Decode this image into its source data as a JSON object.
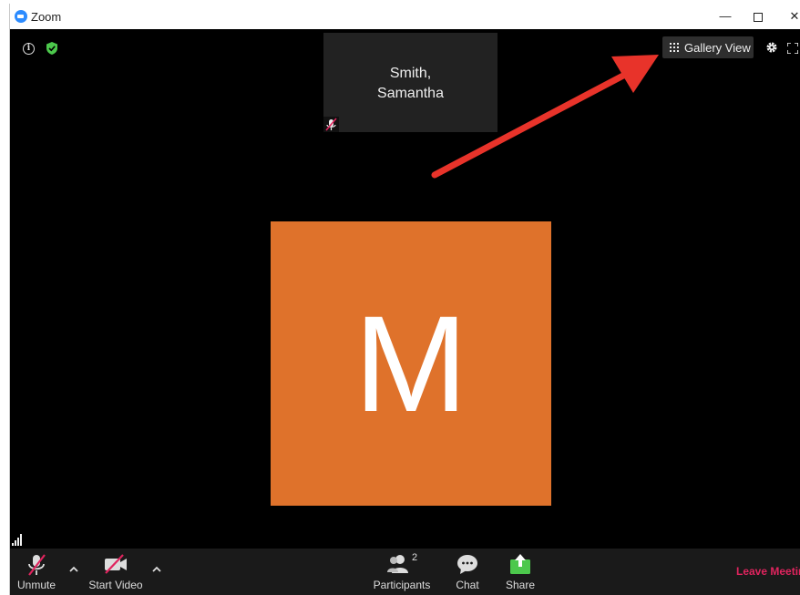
{
  "window": {
    "title": "Zoom",
    "controls": {
      "minimize": "—",
      "maximize": "",
      "close": "✕"
    }
  },
  "stage": {
    "info_icon": "i",
    "thumbnail": {
      "name_line1": "Smith,",
      "name_line2": "Samantha"
    },
    "gallery_view_label": "Gallery View",
    "active_speaker_initial": "M",
    "avatar_color": "#df722b"
  },
  "toolbar": {
    "unmute_label": "Unmute",
    "start_video_label": "Start Video",
    "participants_label": "Participants",
    "participants_count": "2",
    "chat_label": "Chat",
    "share_label": "Share",
    "leave_label": "Leave Meeting"
  },
  "colors": {
    "accent_green": "#4cc84c",
    "leave_red": "#e0245e",
    "annotation_arrow": "#e8332a"
  }
}
